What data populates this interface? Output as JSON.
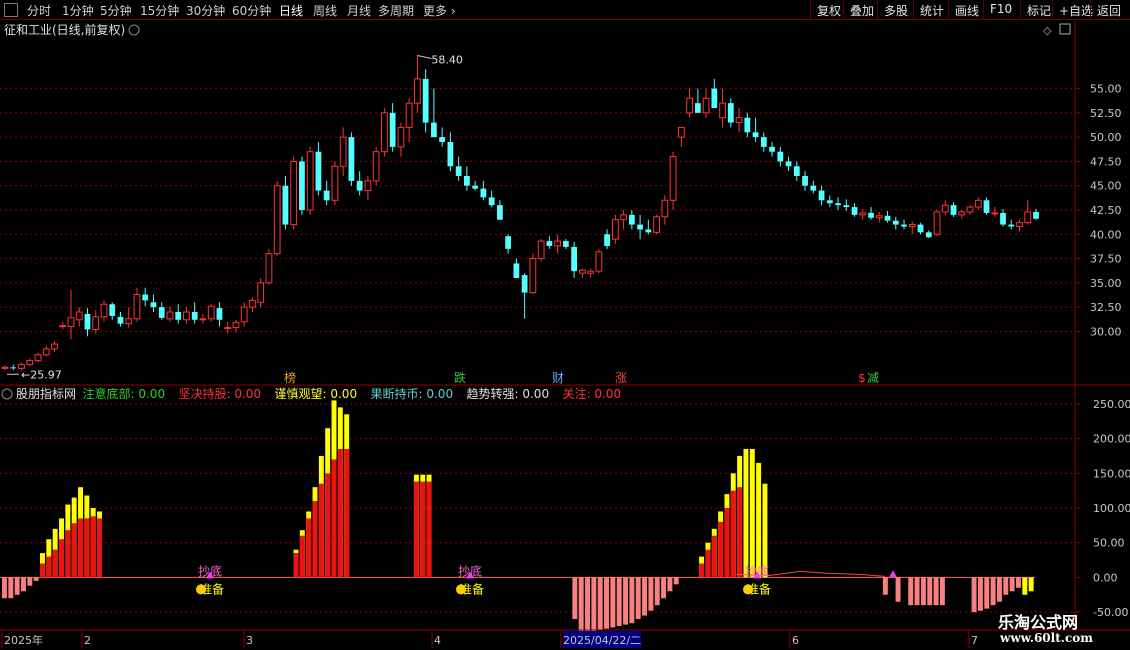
{
  "toolbar": {
    "periods": [
      "分时",
      "1分钟",
      "5分钟",
      "15分钟",
      "30分钟",
      "60分钟",
      "日线",
      "周线",
      "月线",
      "多周期",
      "更多"
    ],
    "active_period": "日线",
    "right_buttons": [
      "复权",
      "叠加",
      "多股",
      "统计",
      "画线",
      "F10",
      "标记",
      "+自选",
      "返回"
    ]
  },
  "stock": {
    "name": "征和工业",
    "mode": "(日线,前复权)"
  },
  "indicator": {
    "name": "股朋指标网",
    "items": [
      {
        "label": "注意底部",
        "value": "0.00",
        "color": "#33cc33"
      },
      {
        "label": "坚决持股",
        "value": "0.00",
        "color": "#ff3333"
      },
      {
        "label": "谨慎观望",
        "value": "0.00",
        "color": "#ffff33"
      },
      {
        "label": "果断持币",
        "value": "0.00",
        "color": "#66cccc"
      },
      {
        "label": "趋势转强",
        "value": "0.00",
        "color": "#e0e0e0"
      },
      {
        "label": "关注",
        "value": "0.00",
        "color": "#ff3333"
      }
    ]
  },
  "price_labels": {
    "high": "58.40",
    "low": "25.97"
  },
  "events": [
    {
      "label": "榜",
      "color": "#e8a020"
    },
    {
      "label": "跌",
      "color": "#33cc33"
    },
    {
      "label": "财",
      "color": "#66aaff"
    },
    {
      "label": "涨",
      "color": "#ff4444"
    },
    {
      "label": "$",
      "color": "#ff3333"
    },
    {
      "label": "减",
      "color": "#33cc33"
    }
  ],
  "signals": {
    "top_text": "抄底",
    "bottom_text": "准备"
  },
  "date_axis": [
    "2025年",
    "2",
    "3",
    "4",
    "2025/04/22/二",
    "6",
    "7"
  ],
  "watermark": {
    "line1": "乐淘公式网",
    "line2": "www.60lt.com"
  },
  "colors": {
    "up": "#ff3333",
    "down": "#54ffff",
    "grid": "#8b0000",
    "axis_text": "#c8c8c8"
  },
  "chart_data": [
    {
      "type": "candlestick",
      "title": "征和工业(日线,前复权)",
      "y_ticks": [
        30.0,
        32.5,
        35.0,
        37.5,
        40.0,
        42.5,
        45.0,
        47.5,
        50.0,
        52.5,
        55.0
      ],
      "ylim": [
        25.0,
        60.0
      ],
      "ohlc": [
        [
          26.2,
          26.5,
          26.0,
          26.3
        ],
        [
          26.3,
          26.6,
          26.0,
          26.2
        ],
        [
          26.2,
          26.8,
          26.0,
          26.6
        ],
        [
          26.6,
          27.2,
          26.4,
          27.0
        ],
        [
          27.0,
          27.8,
          26.8,
          27.6
        ],
        [
          27.6,
          28.5,
          27.4,
          28.2
        ],
        [
          28.2,
          29.0,
          27.9,
          28.7
        ],
        [
          30.6,
          31.0,
          30.2,
          30.6
        ],
        [
          30.5,
          34.3,
          29.2,
          31.4
        ],
        [
          31.2,
          32.5,
          30.5,
          32.0
        ],
        [
          31.8,
          32.4,
          29.5,
          30.2
        ],
        [
          30.2,
          32.2,
          29.8,
          31.5
        ],
        [
          31.5,
          33.2,
          31.0,
          32.8
        ],
        [
          32.8,
          33.0,
          31.2,
          31.6
        ],
        [
          31.5,
          32.0,
          30.5,
          30.8
        ],
        [
          30.8,
          32.5,
          30.4,
          31.3
        ],
        [
          31.3,
          34.5,
          31.0,
          33.8
        ],
        [
          33.8,
          34.5,
          32.6,
          33.2
        ],
        [
          33.0,
          33.8,
          32.0,
          32.5
        ],
        [
          32.5,
          33.0,
          31.2,
          31.4
        ],
        [
          31.3,
          32.6,
          31.0,
          32.0
        ],
        [
          32.0,
          32.8,
          30.8,
          31.2
        ],
        [
          31.2,
          32.5,
          30.8,
          32.0
        ],
        [
          32.0,
          33.0,
          30.8,
          31.2
        ],
        [
          31.2,
          31.8,
          30.8,
          31.3
        ],
        [
          31.3,
          32.8,
          31.0,
          32.6
        ],
        [
          32.4,
          33.0,
          30.5,
          31.2
        ],
        [
          30.4,
          31.0,
          29.8,
          30.4
        ],
        [
          30.4,
          31.2,
          29.9,
          30.9
        ],
        [
          31.0,
          33.0,
          30.5,
          32.5
        ],
        [
          32.5,
          33.5,
          32.0,
          33.2
        ],
        [
          33.0,
          35.5,
          32.5,
          35.0
        ],
        [
          35.0,
          38.5,
          34.8,
          38.0
        ],
        [
          38.0,
          45.5,
          37.8,
          45.0
        ],
        [
          45.0,
          46.0,
          40.5,
          41.0
        ],
        [
          41.0,
          48.0,
          40.5,
          47.5
        ],
        [
          47.5,
          48.0,
          42.0,
          42.5
        ],
        [
          42.5,
          49.0,
          42.0,
          48.5
        ],
        [
          48.5,
          49.5,
          44.0,
          44.5
        ],
        [
          44.5,
          45.5,
          43.0,
          43.5
        ],
        [
          43.5,
          47.5,
          43.0,
          47.0
        ],
        [
          47.0,
          51.0,
          46.0,
          50.0
        ],
        [
          50.0,
          50.5,
          45.0,
          45.5
        ],
        [
          45.5,
          46.5,
          44.0,
          44.5
        ],
        [
          44.5,
          46.0,
          43.5,
          45.5
        ],
        [
          45.5,
          49.0,
          45.0,
          48.5
        ],
        [
          48.5,
          53.0,
          48.0,
          52.5
        ],
        [
          52.5,
          53.5,
          48.5,
          49.0
        ],
        [
          49.0,
          51.5,
          48.0,
          51.0
        ],
        [
          51.0,
          54.0,
          49.5,
          53.5
        ],
        [
          53.5,
          58.4,
          52.5,
          56.0
        ],
        [
          56.0,
          57.0,
          50.5,
          51.5
        ],
        [
          51.5,
          55.0,
          50.0,
          50.0
        ],
        [
          50.0,
          51.0,
          49.0,
          49.5
        ],
        [
          49.5,
          50.5,
          46.5,
          47.0
        ],
        [
          47.0,
          48.0,
          45.5,
          46.0
        ],
        [
          46.0,
          47.0,
          44.5,
          45.0
        ],
        [
          45.0,
          45.5,
          44.5,
          44.7
        ],
        [
          44.7,
          45.5,
          43.5,
          43.8
        ],
        [
          43.8,
          44.5,
          42.8,
          43.0
        ],
        [
          43.0,
          43.5,
          41.5,
          41.5
        ],
        [
          39.8,
          40.0,
          38.0,
          38.5
        ],
        [
          37.0,
          37.5,
          35.5,
          35.5
        ],
        [
          35.8,
          36.0,
          31.3,
          34.0
        ],
        [
          34.0,
          38.0,
          33.8,
          37.5
        ],
        [
          37.5,
          39.5,
          37.2,
          39.3
        ],
        [
          39.3,
          39.8,
          38.5,
          38.8
        ],
        [
          38.8,
          40.0,
          38.0,
          39.3
        ],
        [
          39.3,
          39.5,
          38.5,
          38.7
        ],
        [
          38.7,
          39.2,
          35.5,
          36.2
        ],
        [
          36.0,
          36.5,
          35.5,
          36.3
        ],
        [
          36.0,
          36.5,
          35.5,
          36.2
        ],
        [
          36.2,
          38.5,
          36.0,
          38.2
        ],
        [
          40.0,
          40.5,
          38.5,
          38.8
        ],
        [
          39.5,
          42.0,
          39.0,
          41.5
        ],
        [
          41.5,
          42.5,
          40.5,
          42.0
        ],
        [
          42.0,
          42.5,
          40.5,
          41.0
        ],
        [
          41.0,
          42.0,
          39.5,
          40.5
        ],
        [
          40.5,
          41.5,
          40.0,
          40.2
        ],
        [
          40.2,
          42.0,
          40.0,
          41.8
        ],
        [
          41.8,
          44.0,
          41.0,
          43.5
        ],
        [
          43.5,
          48.5,
          42.5,
          48.0
        ],
        [
          50.0,
          51.0,
          49.0,
          51.0
        ],
        [
          52.5,
          55.0,
          52.0,
          54.0
        ],
        [
          53.5,
          55.0,
          52.5,
          52.5
        ],
        [
          52.5,
          55.0,
          52.0,
          54.0
        ],
        [
          55.0,
          56.0,
          53.0,
          53.0
        ],
        [
          52.0,
          55.0,
          51.0,
          53.5
        ],
        [
          53.5,
          54.0,
          51.0,
          51.5
        ],
        [
          51.5,
          53.0,
          50.5,
          52.0
        ],
        [
          52.0,
          52.5,
          50.0,
          50.5
        ],
        [
          50.5,
          52.0,
          49.5,
          50.0
        ],
        [
          50.0,
          50.5,
          48.5,
          49.0
        ],
        [
          49.0,
          49.5,
          48.0,
          48.5
        ],
        [
          48.5,
          49.0,
          47.0,
          47.5
        ],
        [
          47.5,
          48.0,
          46.5,
          47.0
        ],
        [
          47.0,
          47.5,
          45.5,
          46.0
        ],
        [
          46.0,
          46.5,
          44.5,
          45.0
        ],
        [
          45.0,
          45.5,
          44.2,
          44.5
        ],
        [
          44.5,
          45.0,
          43.0,
          43.5
        ],
        [
          43.5,
          44.0,
          42.8,
          43.2
        ],
        [
          43.2,
          43.8,
          42.5,
          43.0
        ],
        [
          43.0,
          43.6,
          42.4,
          42.8
        ],
        [
          42.8,
          43.2,
          41.8,
          42.0
        ],
        [
          42.0,
          42.6,
          41.5,
          42.2
        ],
        [
          42.2,
          42.8,
          41.5,
          41.7
        ],
        [
          41.7,
          42.3,
          41.2,
          41.9
        ],
        [
          41.9,
          42.4,
          41.2,
          41.4
        ],
        [
          41.4,
          41.8,
          40.5,
          41.0
        ],
        [
          41.0,
          41.5,
          40.5,
          40.8
        ],
        [
          40.8,
          41.3,
          40.0,
          41.0
        ],
        [
          41.0,
          41.2,
          40.0,
          40.2
        ],
        [
          40.2,
          40.4,
          39.6,
          39.7
        ],
        [
          40.0,
          42.5,
          39.8,
          42.3
        ],
        [
          42.3,
          43.5,
          42.0,
          43.0
        ],
        [
          43.0,
          43.3,
          41.8,
          42.0
        ],
        [
          42.0,
          42.5,
          41.6,
          42.3
        ],
        [
          42.3,
          43.0,
          42.0,
          42.8
        ],
        [
          42.8,
          43.8,
          42.5,
          43.5
        ],
        [
          43.5,
          43.8,
          42.0,
          42.2
        ],
        [
          42.2,
          42.8,
          41.8,
          42.2
        ],
        [
          42.2,
          42.6,
          40.8,
          41.0
        ],
        [
          41.0,
          41.5,
          40.5,
          40.8
        ],
        [
          40.8,
          41.5,
          40.3,
          41.2
        ],
        [
          41.2,
          43.5,
          41.0,
          42.3
        ],
        [
          42.3,
          42.6,
          41.5,
          41.6
        ]
      ]
    },
    {
      "type": "bar",
      "title": "股朋指标网",
      "y_ticks": [
        -50.0,
        0.0,
        50.0,
        100.0,
        150.0,
        200.0,
        250.0
      ],
      "ylim": [
        -70,
        270
      ],
      "red": [
        -30,
        -30,
        -25,
        -20,
        -12,
        -5,
        20,
        30,
        40,
        55,
        68,
        78,
        85,
        85,
        88,
        85,
        0,
        0,
        0,
        0,
        0,
        0,
        0,
        0,
        0,
        0,
        0,
        0,
        0,
        0,
        0,
        0,
        0,
        0,
        0,
        0,
        0,
        0,
        0,
        0,
        0,
        0,
        0,
        0,
        0,
        0,
        35,
        60,
        85,
        110,
        135,
        150,
        170,
        185,
        185,
        0,
        0,
        0,
        0,
        0,
        0,
        0,
        0,
        0,
        0,
        138,
        138,
        138,
        0,
        0,
        0,
        0,
        0,
        0,
        0,
        0,
        0,
        0,
        0,
        0,
        0,
        0,
        0,
        0,
        0,
        0,
        0,
        0,
        0,
        0,
        -60,
        -80,
        -80,
        -78,
        -76,
        -74,
        -72,
        -70,
        -68,
        -66,
        -60,
        -55,
        -48,
        -40,
        -30,
        -20,
        -10,
        0,
        0,
        0,
        20,
        40,
        60,
        80,
        100,
        125,
        130,
        0,
        0,
        0,
        0,
        0,
        0,
        0,
        0,
        0,
        0,
        0,
        0,
        0,
        0,
        0,
        0,
        0,
        0,
        0,
        0,
        0,
        0,
        -25,
        0,
        -35,
        0,
        -40,
        -40,
        -40,
        -40,
        -40,
        -40,
        0,
        0,
        0,
        0,
        -50,
        -48,
        -45,
        -40,
        -35,
        -25,
        -20,
        -15,
        -12,
        -12
      ],
      "yellow": [
        0,
        0,
        0,
        0,
        0,
        0,
        35,
        55,
        70,
        85,
        105,
        115,
        130,
        118,
        100,
        95,
        0,
        0,
        0,
        0,
        0,
        0,
        0,
        0,
        0,
        0,
        0,
        0,
        0,
        0,
        0,
        0,
        0,
        0,
        0,
        0,
        0,
        0,
        0,
        0,
        0,
        0,
        0,
        0,
        0,
        0,
        40,
        68,
        95,
        130,
        175,
        215,
        255,
        245,
        235,
        0,
        0,
        0,
        0,
        0,
        0,
        0,
        0,
        0,
        0,
        148,
        148,
        148,
        0,
        0,
        0,
        0,
        0,
        0,
        0,
        0,
        0,
        0,
        0,
        0,
        0,
        0,
        0,
        0,
        0,
        0,
        0,
        0,
        0,
        0,
        0,
        0,
        0,
        0,
        0,
        0,
        0,
        0,
        0,
        0,
        0,
        0,
        0,
        0,
        0,
        0,
        0,
        0,
        0,
        0,
        30,
        50,
        70,
        95,
        120,
        150,
        175,
        185,
        185,
        165,
        135,
        0,
        0,
        0,
        0,
        0,
        0,
        0,
        0,
        0,
        0,
        0,
        0,
        0,
        0,
        0,
        0,
        0,
        0,
        0,
        0,
        0,
        0,
        0,
        0,
        0,
        0,
        0,
        0,
        0,
        0,
        0,
        0,
        0,
        0,
        0,
        0,
        0,
        0,
        0,
        0,
        -25,
        -20,
        -15,
        -10,
        -5
      ]
    }
  ]
}
